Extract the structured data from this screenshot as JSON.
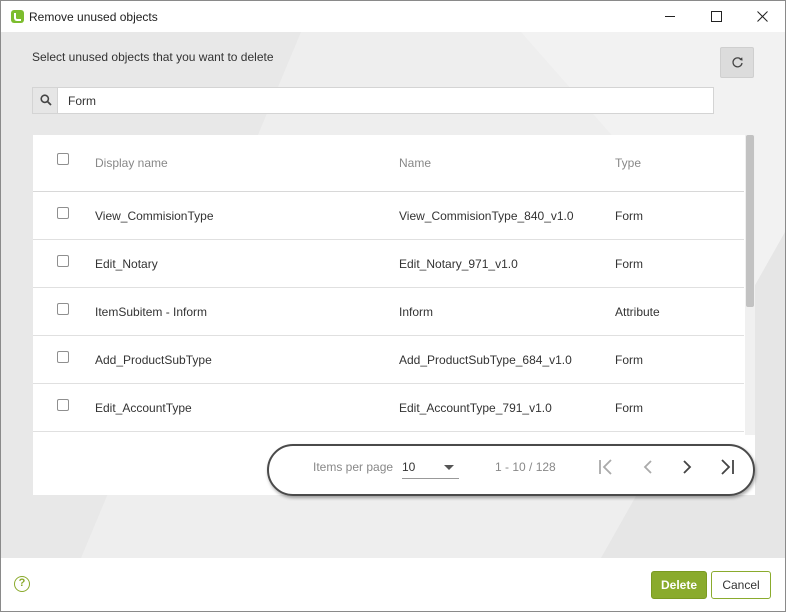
{
  "window": {
    "title": "Remove unused objects",
    "app_icon": "bizagi-logo-icon",
    "controls": [
      "minimize-icon",
      "maximize-icon",
      "close-icon"
    ]
  },
  "instruction": "Select unused objects that you want to delete",
  "refresh": {
    "icon": "refresh-icon"
  },
  "search": {
    "icon": "search-icon",
    "value": "Form"
  },
  "table": {
    "headers": {
      "display_name": "Display name",
      "name": "Name",
      "type": "Type"
    },
    "rows": [
      {
        "display_name": "View_CommisionType",
        "name": "View_CommisionType_840_v1.0",
        "type": "Form",
        "checked": false
      },
      {
        "display_name": "Edit_Notary",
        "name": "Edit_Notary_971_v1.0",
        "type": "Form",
        "checked": false
      },
      {
        "display_name": "ItemSubitem - Inform",
        "name": "Inform",
        "type": "Attribute",
        "checked": false
      },
      {
        "display_name": "Add_ProductSubType",
        "name": "Add_ProductSubType_684_v1.0",
        "type": "Form",
        "checked": false
      },
      {
        "display_name": "Edit_AccountType",
        "name": "Edit_AccountType_791_v1.0",
        "type": "Form",
        "checked": false
      }
    ]
  },
  "pager": {
    "items_per_page_label": "Items per page",
    "items_per_page_value": "10",
    "range": "1 - 10 / 128",
    "icons": [
      "first-page-icon",
      "previous-page-icon",
      "next-page-icon",
      "last-page-icon"
    ]
  },
  "footer": {
    "help_label": "?",
    "delete_label": "Delete",
    "cancel_label": "Cancel"
  },
  "colors": {
    "accent": "#8aab2d",
    "background": "#eeeeee",
    "panel": "#ffffff"
  }
}
